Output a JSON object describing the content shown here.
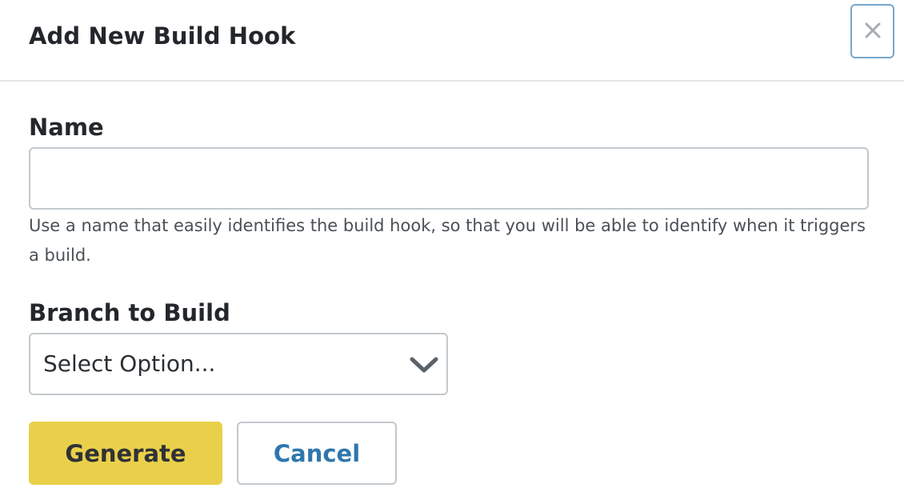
{
  "modal": {
    "title": "Add New Build Hook",
    "close_icon": "close-icon"
  },
  "name_field": {
    "label": "Name",
    "value": "",
    "placeholder": "",
    "help_text": "Use a name that easily identifies the build hook, so that you will be able to identify when it triggers a build."
  },
  "branch_field": {
    "label": "Branch to Build",
    "selected": "Select Option...",
    "icon": "chevron-down-icon"
  },
  "actions": {
    "generate_label": "Generate",
    "cancel_label": "Cancel"
  },
  "colors": {
    "primary_button": "#ead04a",
    "link_text": "#2f76ad",
    "close_border": "#76a7cc",
    "input_border": "#c3c8cd"
  }
}
